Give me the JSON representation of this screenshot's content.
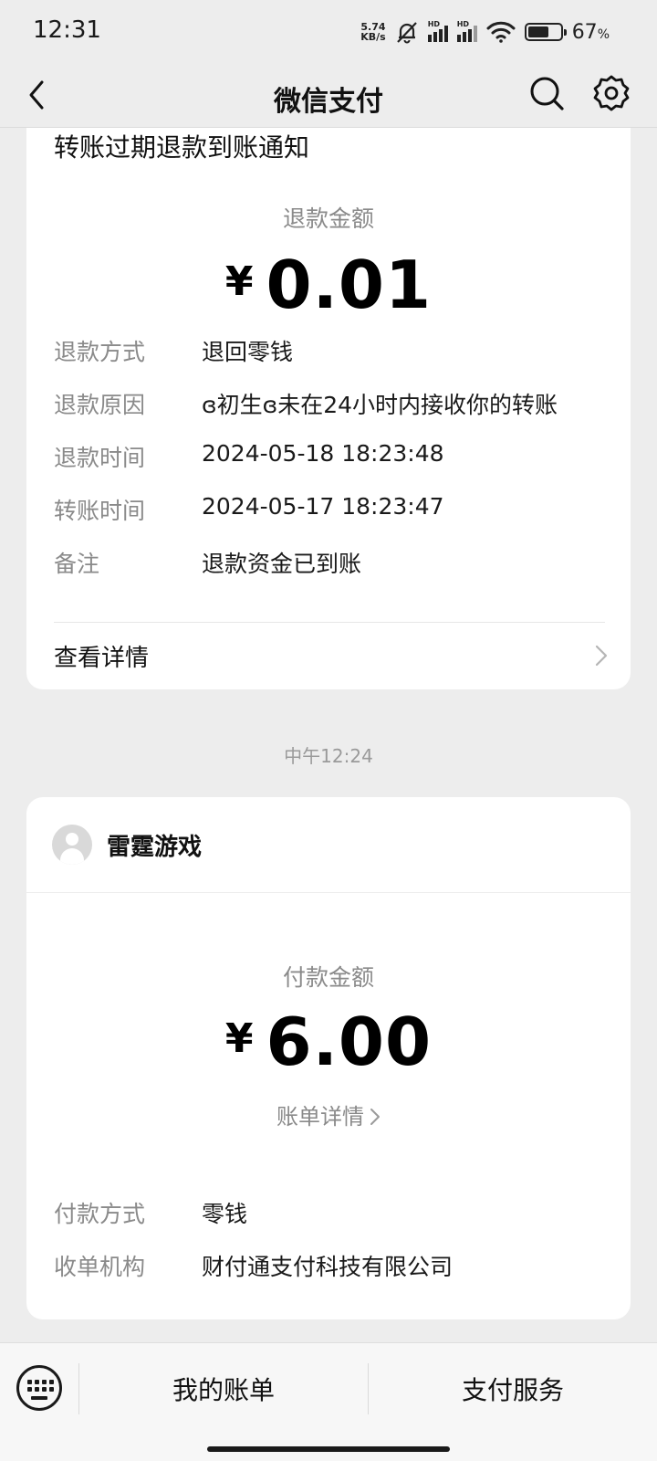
{
  "status_bar": {
    "time": "12:31",
    "net_speed_value": "5.74",
    "net_speed_unit": "KB/s",
    "hd_label": "HD",
    "battery_percent": "67",
    "battery_unit": "%",
    "battery_level": 0.67
  },
  "nav": {
    "title": "微信支付"
  },
  "refund_card": {
    "title": "转账过期退款到账通知",
    "amount_label": "退款金额",
    "currency": "¥",
    "amount": "0.01",
    "rows": [
      {
        "key": "退款方式",
        "value": "退回零钱"
      },
      {
        "key": "退款原因",
        "value": "ɞ初生ɞ未在24小时内接收你的转账"
      },
      {
        "key": "退款时间",
        "value": "2024-05-18 18:23:48"
      },
      {
        "key": "转账时间",
        "value": "2024-05-17 18:23:47"
      },
      {
        "key": "备注",
        "value": "退款资金已到账"
      }
    ],
    "detail_label": "查看详情"
  },
  "time_divider": "中午12:24",
  "payment_card": {
    "merchant": "雷霆游戏",
    "amount_label": "付款金额",
    "currency": "¥",
    "amount": "6.00",
    "bill_link": "账单详情",
    "rows": [
      {
        "key": "付款方式",
        "value": "零钱"
      },
      {
        "key": "收单机构",
        "value": "财付通支付科技有限公司"
      }
    ]
  },
  "bottom_bar": {
    "tab1": "我的账单",
    "tab2": "支付服务"
  }
}
